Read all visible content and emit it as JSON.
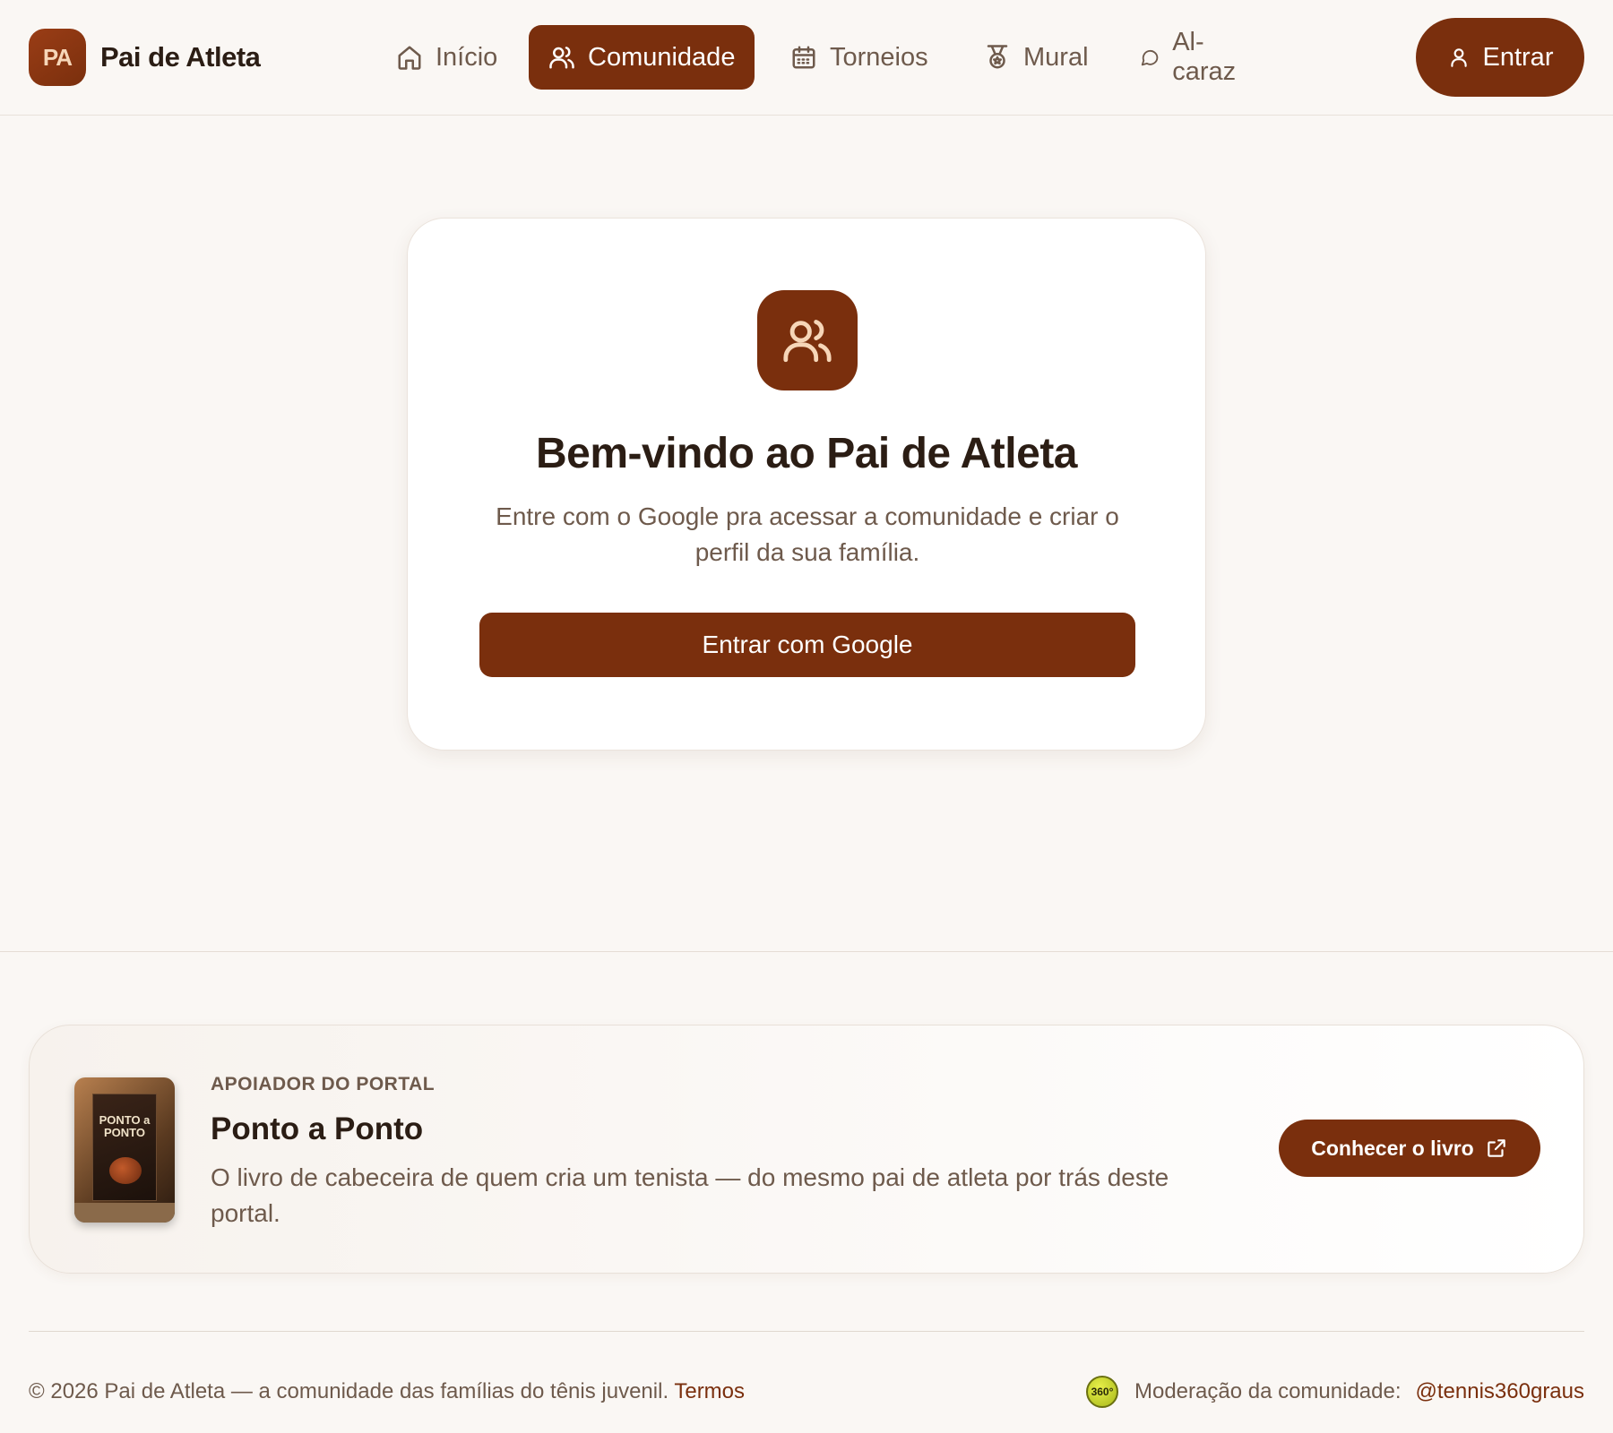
{
  "brand": {
    "badge": "PA",
    "name": "Pai de Atleta"
  },
  "nav": {
    "items": [
      {
        "label": "Início",
        "icon": "home-icon",
        "active": false
      },
      {
        "label": "Comunidade",
        "icon": "users-icon",
        "active": true
      },
      {
        "label": "Torneios",
        "icon": "calendar-icon",
        "active": false
      },
      {
        "label": "Mural",
        "icon": "medal-icon",
        "active": false
      },
      {
        "label": "Al-caraz",
        "icon": "chat-bubble-icon",
        "active": false
      }
    ],
    "login_label": "Entrar"
  },
  "login_card": {
    "icon": "users-icon",
    "title": "Bem-vindo ao Pai de Atleta",
    "description": "Entre com o Google pra acessar a comunidade e criar o perfil da sua família.",
    "button_label": "Entrar com Google"
  },
  "sponsor": {
    "tag": "APOIADOR DO PORTAL",
    "title": "Ponto a Ponto",
    "description": "O livro de cabeceira de quem cria um tenista — do mesmo pai de atleta por trás deste portal.",
    "button_label": "Conhecer o livro",
    "book_cover_text": "PONTO a PONTO"
  },
  "footer": {
    "copyright": "© 2026 Pai de Atleta — a comunidade das famílias do tênis juvenil.",
    "terms_label": "Termos",
    "moderation_label": "Moderação da comunidade:",
    "moderation_handle": "@tennis360graus",
    "badge_text": "360°"
  },
  "colors": {
    "accent": "#7a2f0d",
    "background": "#faf7f4",
    "text": "#2b1d14",
    "muted": "#6e5a4c"
  }
}
